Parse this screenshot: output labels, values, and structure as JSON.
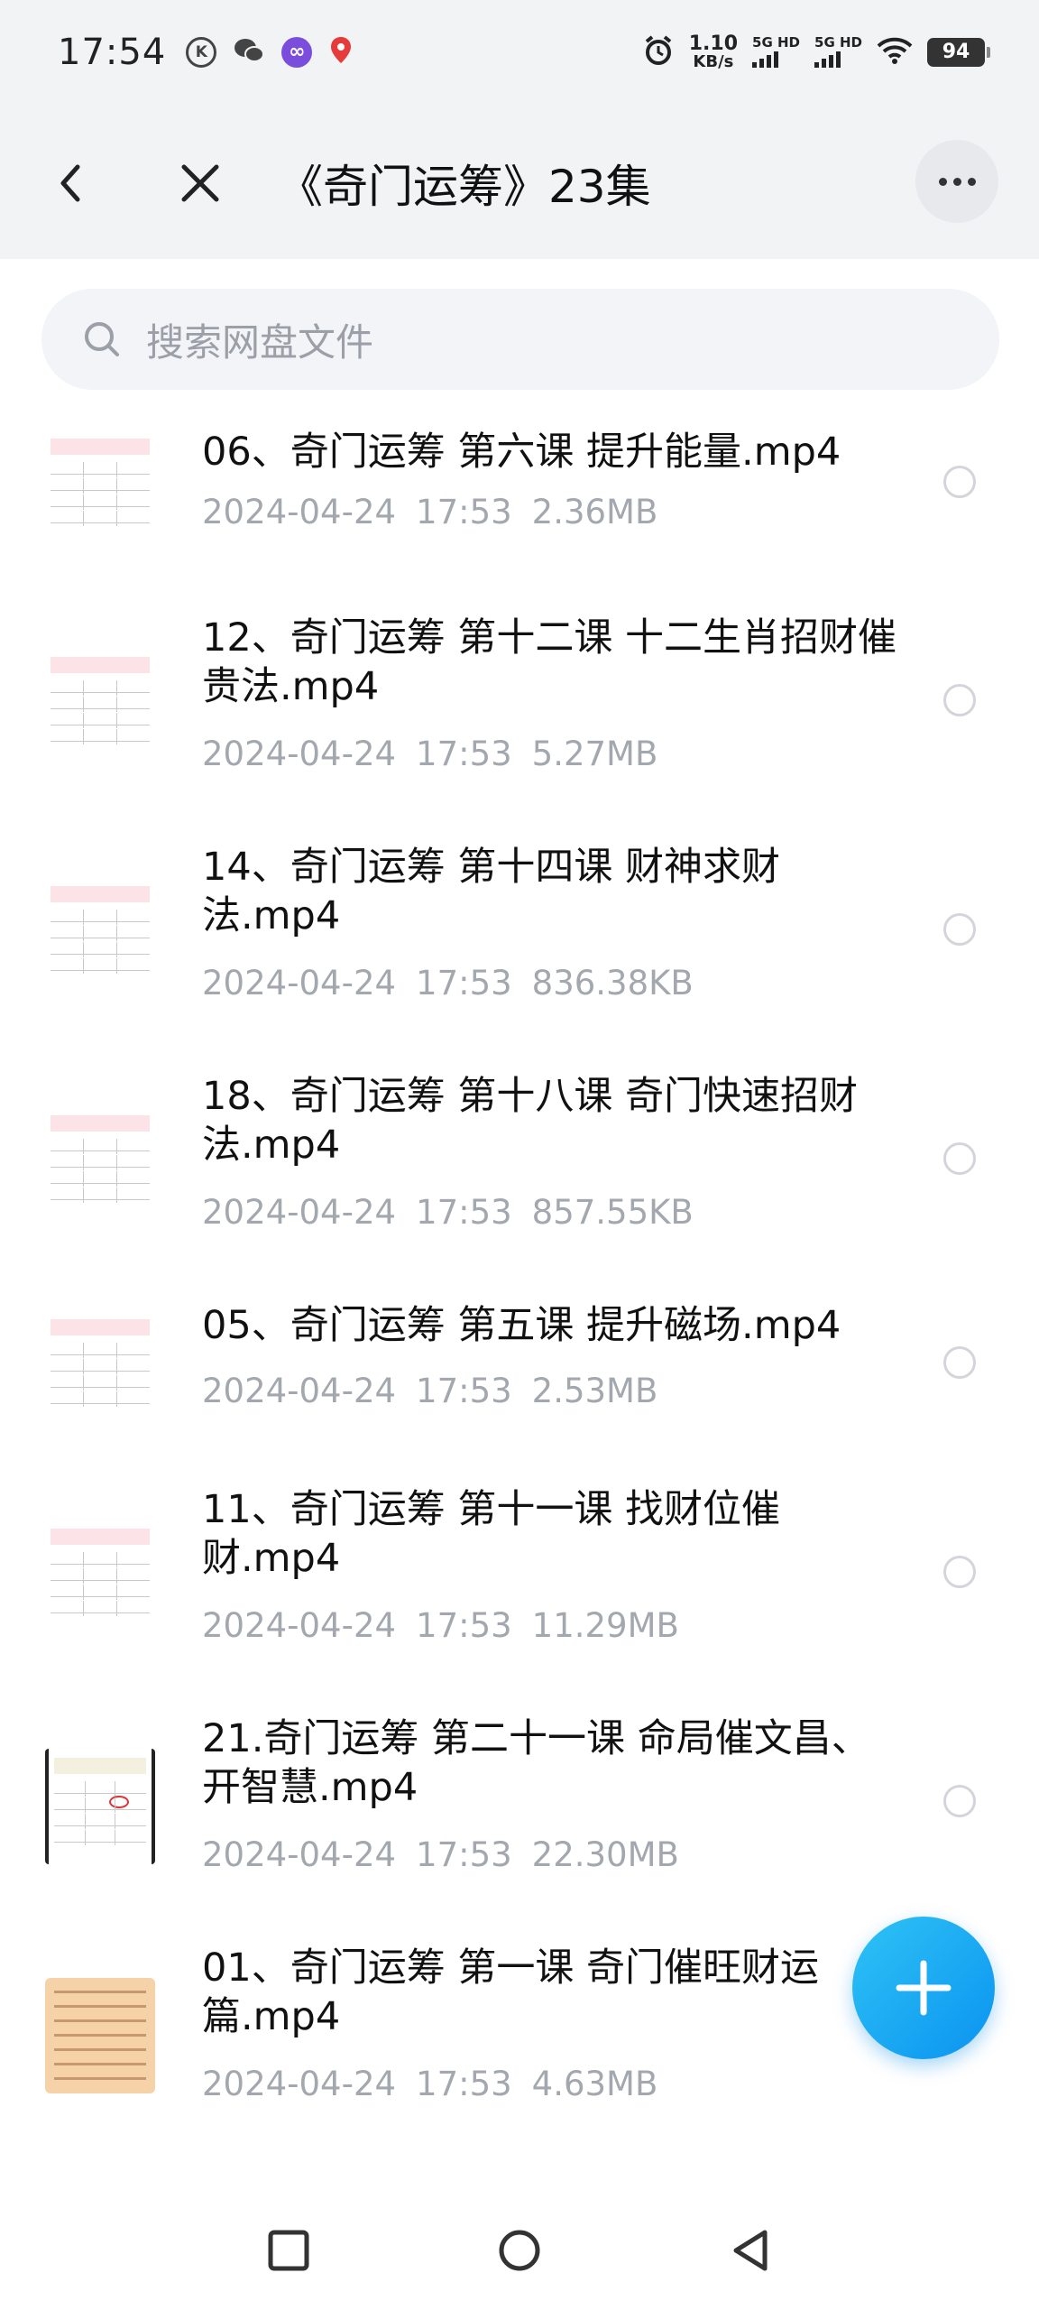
{
  "status_bar": {
    "time": "17:54",
    "left_icons": [
      "k-circle-icon",
      "wechat-icon",
      "infinity-app-icon",
      "location-pin-icon"
    ],
    "net_speed_value": "1.10",
    "net_speed_unit": "KB/s",
    "sim1_label": "5G HD",
    "sim2_label": "5G HD",
    "battery": "94"
  },
  "header": {
    "title": "《奇门运筹》23集"
  },
  "search": {
    "placeholder": "搜索网盘文件"
  },
  "files": [
    {
      "name": "06、奇门运筹 第六课 提升能量.mp4",
      "date": "2024-04-24",
      "time": "17:53",
      "size": "2.36MB",
      "thumb": "chart"
    },
    {
      "name": "12、奇门运筹 第十二课 十二生肖招财催贵法.mp4",
      "date": "2024-04-24",
      "time": "17:53",
      "size": "5.27MB",
      "thumb": "chart"
    },
    {
      "name": "14、奇门运筹 第十四课 财神求财法.mp4",
      "date": "2024-04-24",
      "time": "17:53",
      "size": "836.38KB",
      "thumb": "chart"
    },
    {
      "name": "18、奇门运筹 第十八课 奇门快速招财法.mp4",
      "date": "2024-04-24",
      "time": "17:53",
      "size": "857.55KB",
      "thumb": "chart"
    },
    {
      "name": "05、奇门运筹 第五课 提升磁场.mp4",
      "date": "2024-04-24",
      "time": "17:53",
      "size": "2.53MB",
      "thumb": "chart"
    },
    {
      "name": "11、奇门运筹 第十一课 找财位催财.mp4",
      "date": "2024-04-24",
      "time": "17:53",
      "size": "11.29MB",
      "thumb": "chart"
    },
    {
      "name": "21.奇门运筹 第二十一课 命局催文昌、开智慧.mp4",
      "date": "2024-04-24",
      "time": "17:53",
      "size": "22.30MB",
      "thumb": "chart-dark"
    },
    {
      "name": "01、奇门运筹 第一课 奇门催旺财运篇.mp4",
      "date": "2024-04-24",
      "time": "17:53",
      "size": "4.63MB",
      "thumb": "paper"
    }
  ],
  "fab": {
    "icon": "plus-icon"
  },
  "nav_bar": {
    "icons": [
      "recents-square-icon",
      "home-circle-icon",
      "back-triangle-icon"
    ]
  },
  "colors": {
    "accent": "#0a93f0",
    "meta_text": "#a3a7ae",
    "header_bg": "#f2f3f5"
  }
}
